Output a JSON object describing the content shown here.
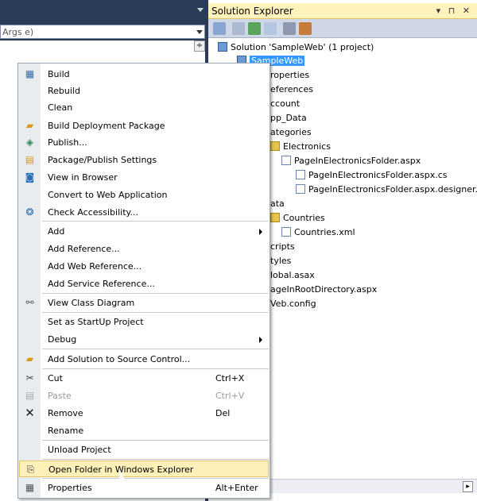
{
  "editor": {
    "member_combo_text": "Args e)"
  },
  "solution_explorer": {
    "title": "Solution Explorer",
    "controls": "▾ ⊓ ✕",
    "tree": [
      {
        "label": "Solution 'SampleWeb' (1 project)",
        "icon": "solution-icon"
      },
      {
        "label": "SampleWeb",
        "icon": "web-project-icon",
        "selected": true
      },
      {
        "label": "roperties"
      },
      {
        "label": "eferences"
      },
      {
        "label": "ccount"
      },
      {
        "label": "pp_Data"
      },
      {
        "label": "ategories"
      },
      {
        "label": "Electronics",
        "icon": "folder-icon"
      },
      {
        "label": "PageInElectronicsFolder.aspx",
        "icon": "aspx-file-icon"
      },
      {
        "label": "PageInElectronicsFolder.aspx.cs",
        "icon": "cs-file-icon"
      },
      {
        "label": "PageInElectronicsFolder.aspx.designer.c",
        "icon": "cs-file-icon"
      },
      {
        "label": "ata"
      },
      {
        "label": "Countries",
        "icon": "folder-icon"
      },
      {
        "label": "Countries.xml",
        "icon": "xml-file-icon"
      },
      {
        "label": "cripts"
      },
      {
        "label": "tyles"
      },
      {
        "label": "lobal.asax"
      },
      {
        "label": "ageInRootDirectory.aspx"
      },
      {
        "label": "Veb.config"
      }
    ]
  },
  "context_menu": {
    "items": [
      {
        "label": "Build",
        "icon": "build-icon"
      },
      {
        "label": "Rebuild"
      },
      {
        "label": "Clean"
      },
      {
        "label": "Build Deployment Package",
        "icon": "package-icon"
      },
      {
        "label": "Publish...",
        "icon": "publish-icon"
      },
      {
        "label": "Package/Publish Settings",
        "icon": "settings-icon"
      },
      {
        "label": "View in Browser",
        "icon": "browser-icon"
      },
      {
        "label": "Convert to Web Application"
      },
      {
        "label": "Check Accessibility...",
        "icon": "accessibility-icon"
      },
      {
        "label": "Add",
        "submenu": true
      },
      {
        "label": "Add Reference..."
      },
      {
        "label": "Add Web Reference..."
      },
      {
        "label": "Add Service Reference..."
      },
      {
        "label": "View Class Diagram",
        "icon": "class-diagram-icon"
      },
      {
        "label": "Set as StartUp Project"
      },
      {
        "label": "Debug",
        "submenu": true
      },
      {
        "label": "Add Solution to Source Control...",
        "icon": "source-control-icon"
      },
      {
        "label": "Cut",
        "shortcut": "Ctrl+X",
        "icon": "cut-icon"
      },
      {
        "label": "Paste",
        "shortcut": "Ctrl+V",
        "icon": "paste-icon",
        "disabled": true
      },
      {
        "label": "Remove",
        "shortcut": "Del",
        "icon": "remove-icon"
      },
      {
        "label": "Rename"
      },
      {
        "label": "Unload Project"
      },
      {
        "label": "Open Folder in Windows Explorer",
        "icon": "open-folder-icon",
        "highlighted": true
      },
      {
        "label": "Properties",
        "shortcut": "Alt+Enter",
        "icon": "properties-icon"
      }
    ]
  }
}
